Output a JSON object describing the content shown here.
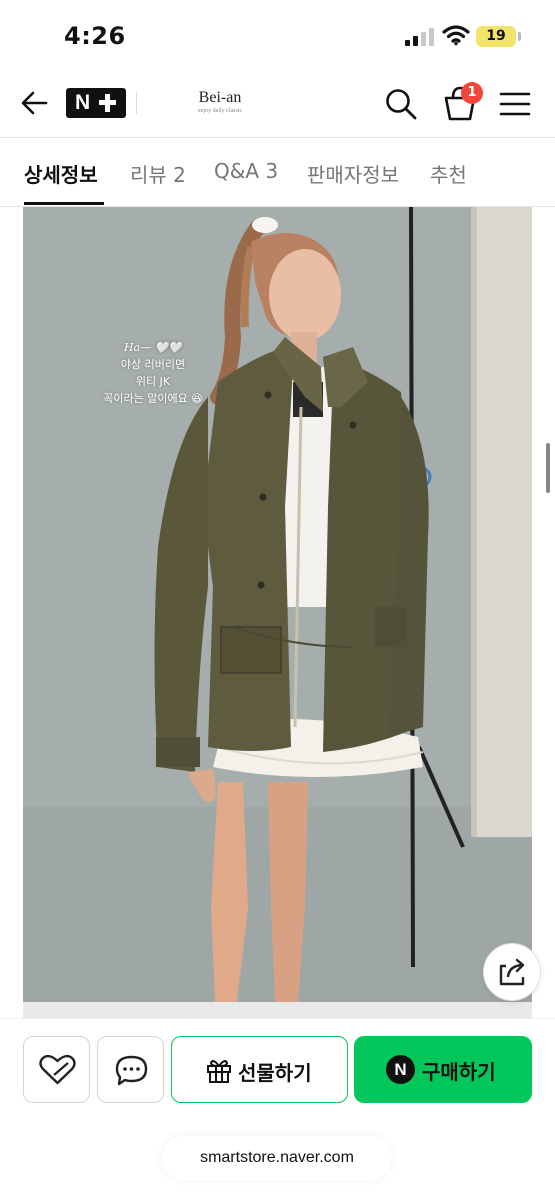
{
  "status_bar": {
    "time": "4:26",
    "battery": "19"
  },
  "header": {
    "logo_text": "N",
    "brand_name": "Bei-an",
    "brand_tagline": "enjoy daily classic",
    "cart_count": "1"
  },
  "tabs": [
    {
      "label": "상세정보",
      "active": true
    },
    {
      "label": "리뷰 2",
      "active": false
    },
    {
      "label": "Q&A 3",
      "active": false
    },
    {
      "label": "판매자정보",
      "active": false
    },
    {
      "label": "추천",
      "active": false
    }
  ],
  "product_image": {
    "caption_line1": "Ha— 🤍🤍",
    "caption_line2": "야상 러버리면",
    "caption_line3": "위티 JK",
    "caption_line4": "꼭이라는 말이에요 😆"
  },
  "actions": {
    "gift_label": "선물하기",
    "buy_label": "구매하기",
    "npay_letter": "N"
  },
  "url": "smartstore.naver.com",
  "colors": {
    "accent_green": "#03c75a",
    "badge_red": "#f0473a",
    "jacket_olive": "#5d5a3c"
  }
}
